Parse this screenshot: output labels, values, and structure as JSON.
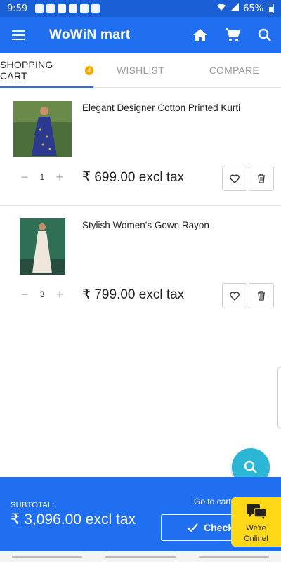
{
  "status": {
    "time": "9:59",
    "battery": "65%"
  },
  "appbar": {
    "title": "WoWiN mart"
  },
  "tabs": [
    {
      "label": "SHOPPING CART",
      "badge": "4"
    },
    {
      "label": "WISHLIST"
    },
    {
      "label": "COMPARE"
    }
  ],
  "cart": {
    "items": [
      {
        "name": "Elegant Designer Cotton Printed Kurti",
        "qty": "1",
        "price": "₹ 699.00 excl tax"
      },
      {
        "name": "Stylish Women's Gown Rayon",
        "qty": "3",
        "price": "₹ 799.00 excl tax"
      }
    ]
  },
  "footer": {
    "subtotal_label": "SUBTOTAL:",
    "subtotal_value": "₹ 3,096.00 excl tax",
    "goto_label": "Go to cart",
    "checkout_label": "Checkout"
  },
  "chat": {
    "line1": "We're",
    "line2": "Online!"
  },
  "colors": {
    "primary": "#1f6ff0",
    "fab": "#2cb6d6",
    "chat": "#ffd817",
    "badge": "#f0a800"
  }
}
